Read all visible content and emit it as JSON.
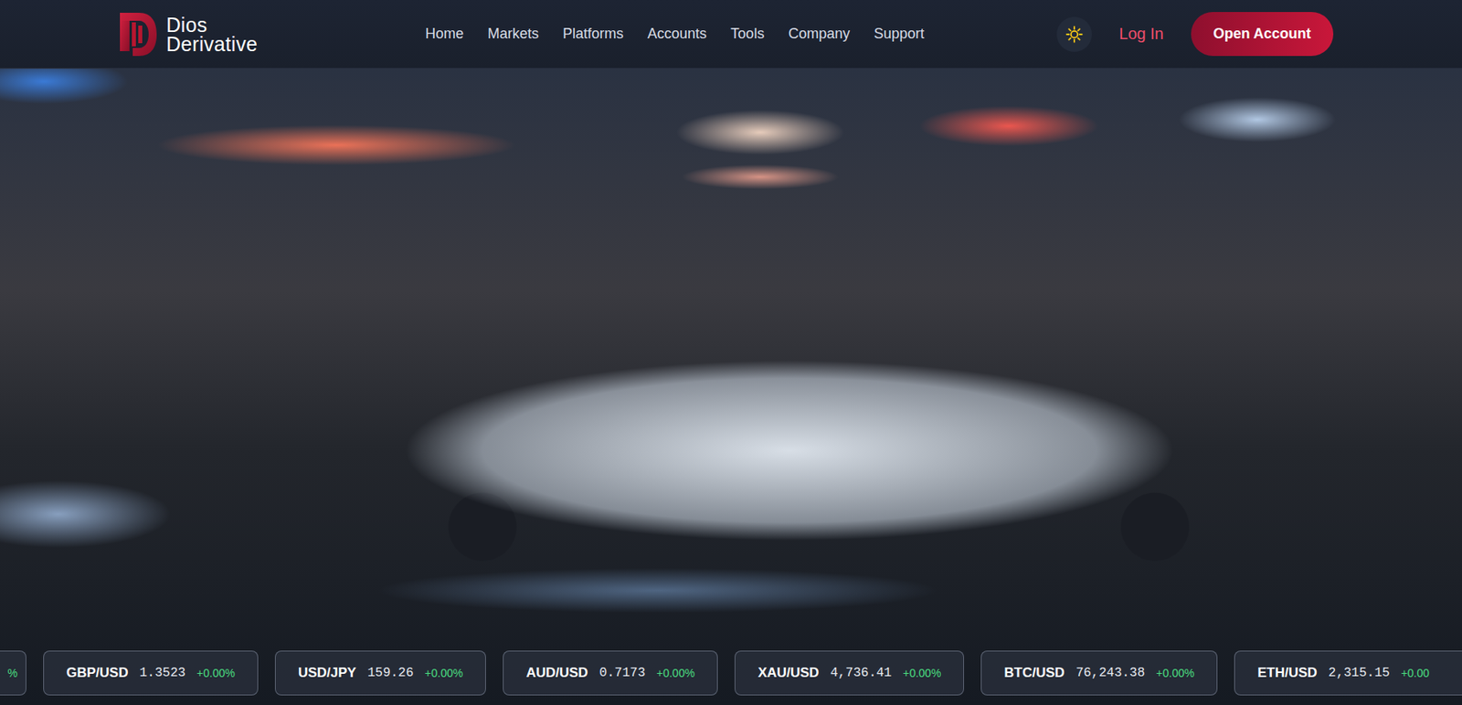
{
  "brand": {
    "line1": "Dios",
    "line2": "Derivative"
  },
  "nav": {
    "items": [
      "Home",
      "Markets",
      "Platforms",
      "Accounts",
      "Tools",
      "Company",
      "Support"
    ]
  },
  "actions": {
    "login": "Log In",
    "open_account": "Open Account"
  },
  "ticker": [
    {
      "kind": "clipped",
      "change": "%"
    },
    {
      "kind": "full",
      "pair": "GBP/USD",
      "price": "1.3523",
      "change": "+0.00%"
    },
    {
      "kind": "full",
      "pair": "USD/JPY",
      "price": "159.26",
      "change": "+0.00%"
    },
    {
      "kind": "full",
      "pair": "AUD/USD",
      "price": "0.7173",
      "change": "+0.00%"
    },
    {
      "kind": "full",
      "pair": "XAU/USD",
      "price": "4,736.41",
      "change": "+0.00%"
    },
    {
      "kind": "full",
      "pair": "BTC/USD",
      "price": "76,243.38",
      "change": "+0.00%"
    },
    {
      "kind": "clipped-right",
      "pair": "ETH/USD",
      "price": "2,315.15",
      "change": "+0.00"
    }
  ]
}
